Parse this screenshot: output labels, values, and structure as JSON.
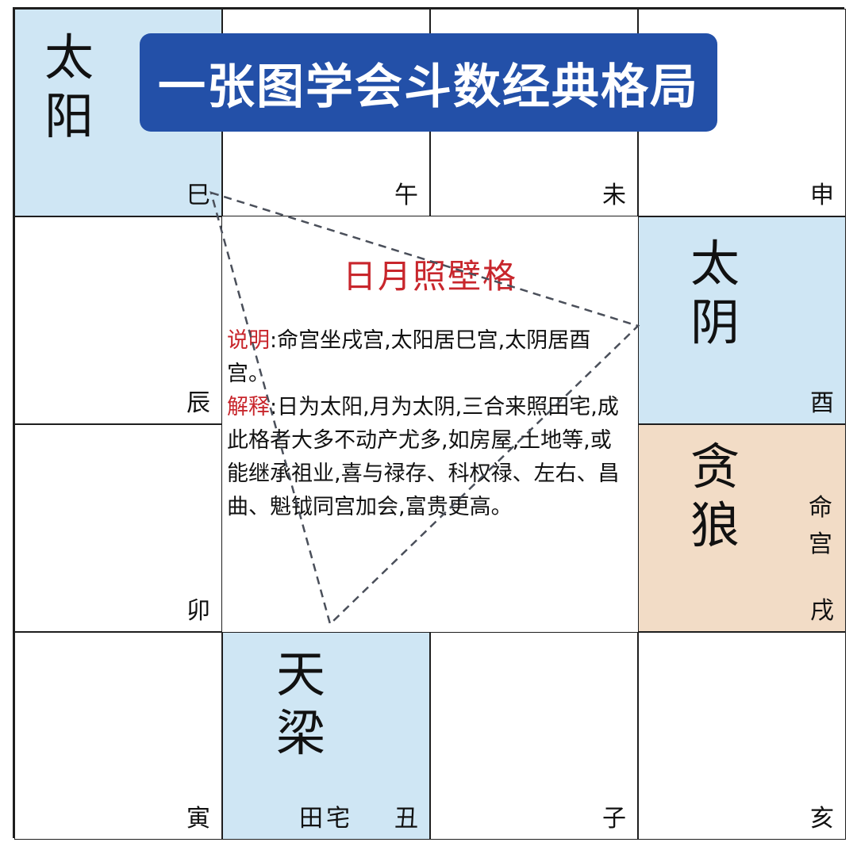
{
  "banner": {
    "title": "一张图学会斗数经典格局"
  },
  "pattern": {
    "name": "日月照壁格",
    "note_label": "说明",
    "note_text": ":命宫坐戌宫,太阳居巳宫,太阴居酉宫。",
    "explain_label": "解释",
    "explain_text": ":日为太阳,月为太阴,三合来照田宅,成此格者大多不动产尤多,如房屋,土地等,或能继承祖业,喜与禄存、科权禄、左右、昌曲、魁钺同宫加会,富贵更高。"
  },
  "palaces": {
    "si": {
      "branch": "巳",
      "star_1": "太",
      "star_2": "阳"
    },
    "wu": {
      "branch": "午"
    },
    "wei": {
      "branch": "未"
    },
    "shen": {
      "branch": "申"
    },
    "chen": {
      "branch": "辰"
    },
    "you": {
      "branch": "酉",
      "star_1": "太",
      "star_2": "阴"
    },
    "mao": {
      "branch": "卯"
    },
    "xu": {
      "branch": "戌",
      "star_1": "贪",
      "star_2": "狼",
      "palace_1": "命",
      "palace_2": "宫"
    },
    "yin": {
      "branch": "寅"
    },
    "chou": {
      "branch": "丑",
      "star_1": "天",
      "star_2": "梁",
      "palace": "田宅"
    },
    "zi": {
      "branch": "子"
    },
    "hai": {
      "branch": "亥"
    }
  },
  "colors": {
    "banner": "#2350a8",
    "highlight_cell": "#cfe6f4",
    "life_palace_cell": "#f2dcc6",
    "accent_text": "#c8262c"
  }
}
